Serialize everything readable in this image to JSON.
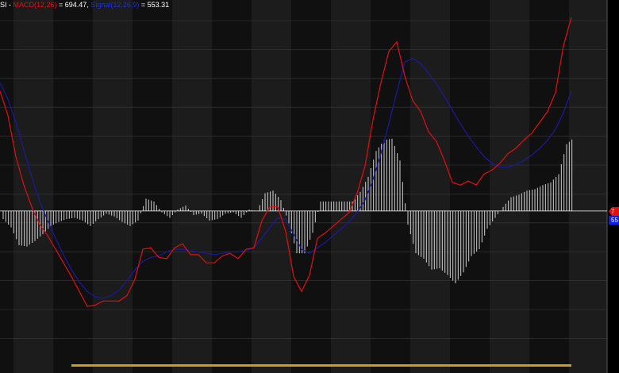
{
  "legend": {
    "prefix": "SI - ",
    "macd_label": "MACD(12,26)",
    "macd_eq": " = 694.47, ",
    "signal_label": "Signal(12,26,9)",
    "signal_eq": " = 553.31"
  },
  "price_tags": {
    "macd_tag": "7",
    "signal_tag": "55"
  },
  "colors": {
    "background_dark": "#101010",
    "background_light": "#1c1c1c",
    "grid": "#3a3a3a",
    "macd": "#e01010",
    "signal": "#1a1aa0",
    "histogram": "#d0d0d0",
    "zero_line": "#ffffff",
    "bottom_strip": "#c8a020"
  },
  "chart_data": {
    "type": "line",
    "title": "",
    "xlabel": "",
    "ylabel": "",
    "ylim": [
      -1100,
      1430
    ],
    "grid": true,
    "series": [
      {
        "name": "MACD(12,26)",
        "color": "#e01010",
        "x": [
          0,
          10,
          20,
          30,
          40,
          50,
          60,
          70,
          80,
          90,
          100,
          110,
          120,
          130,
          140,
          150,
          160,
          170,
          180,
          190,
          200,
          210,
          220,
          230,
          240,
          250,
          260,
          270,
          280,
          290,
          300,
          310,
          320,
          330,
          340,
          350,
          360,
          370,
          380,
          390,
          400,
          410,
          420,
          430,
          440,
          450,
          460,
          470,
          480,
          490,
          500,
          510,
          520,
          530,
          540,
          550,
          560,
          570,
          580,
          590,
          600,
          610,
          620,
          630,
          640,
          650,
          660,
          670,
          680,
          690,
          700,
          710,
          720
        ],
        "values": [
          880,
          700,
          400,
          190,
          30,
          -100,
          -180,
          -280,
          -380,
          -480,
          -590,
          -700,
          -690,
          -660,
          -660,
          -660,
          -620,
          -500,
          -280,
          -270,
          -340,
          -350,
          -270,
          -240,
          -320,
          -320,
          -380,
          -380,
          -330,
          -310,
          -350,
          -280,
          -270,
          -70,
          30,
          30,
          -150,
          -480,
          -590,
          -470,
          -200,
          -160,
          -110,
          -60,
          -10,
          130,
          330,
          670,
          940,
          1170,
          1240,
          990,
          810,
          730,
          580,
          510,
          370,
          210,
          190,
          220,
          190,
          270,
          300,
          350,
          420,
          460,
          520,
          570,
          650,
          730,
          870,
          1210,
          1420
        ]
      },
      {
        "name": "Signal(12,26,9)",
        "color": "#1a1aa0",
        "x": [
          0,
          10,
          20,
          30,
          40,
          50,
          60,
          70,
          80,
          90,
          100,
          110,
          120,
          130,
          140,
          150,
          160,
          170,
          180,
          190,
          200,
          210,
          220,
          230,
          240,
          250,
          260,
          270,
          280,
          290,
          300,
          310,
          320,
          330,
          340,
          350,
          360,
          370,
          380,
          390,
          400,
          410,
          420,
          430,
          440,
          450,
          460,
          470,
          480,
          490,
          500,
          510,
          520,
          530,
          540,
          550,
          560,
          570,
          580,
          590,
          600,
          610,
          620,
          630,
          640,
          650,
          660,
          670,
          680,
          690,
          700,
          710,
          720
        ],
        "values": [
          940,
          820,
          650,
          450,
          250,
          70,
          -70,
          -200,
          -320,
          -430,
          -520,
          -590,
          -630,
          -640,
          -620,
          -580,
          -510,
          -430,
          -370,
          -340,
          -330,
          -300,
          -280,
          -280,
          -290,
          -300,
          -310,
          -320,
          -310,
          -300,
          -300,
          -290,
          -270,
          -200,
          -120,
          -50,
          -60,
          -170,
          -280,
          -310,
          -270,
          -230,
          -180,
          -130,
          -80,
          -10,
          80,
          230,
          420,
          640,
          870,
          1090,
          1120,
          1080,
          1010,
          930,
          840,
          740,
          640,
          550,
          470,
          400,
          350,
          320,
          320,
          340,
          370,
          410,
          460,
          520,
          600,
          720,
          880
        ]
      }
    ],
    "histogram": {
      "name": "MACD - Signal",
      "color": "#d0d0d0",
      "x": [
        0,
        10,
        20,
        30,
        40,
        50,
        60,
        70,
        80,
        90,
        100,
        110,
        120,
        130,
        140,
        150,
        160,
        170,
        180,
        190,
        200,
        210,
        220,
        230,
        240,
        250,
        260,
        270,
        280,
        290,
        300,
        310,
        320,
        330,
        340,
        350,
        360,
        370,
        380,
        390,
        400,
        410,
        420,
        430,
        440,
        450,
        460,
        470,
        480,
        490,
        500,
        510,
        520,
        530,
        540,
        550,
        560,
        570,
        580,
        590,
        600,
        610,
        620,
        630,
        640,
        650,
        660,
        670,
        680,
        690,
        700,
        710,
        720
      ],
      "values": [
        -60,
        -120,
        -250,
        -260,
        -220,
        -170,
        -110,
        -80,
        -60,
        -50,
        -70,
        -110,
        -60,
        -20,
        -40,
        -80,
        -110,
        -70,
        90,
        70,
        -10,
        -50,
        10,
        40,
        -30,
        -20,
        -70,
        -60,
        -20,
        -10,
        -50,
        10,
        0,
        130,
        150,
        80,
        -90,
        -310,
        -310,
        -160,
        70,
        70,
        70,
        70,
        70,
        140,
        250,
        440,
        520,
        530,
        370,
        -100,
        -310,
        -350,
        -430,
        -420,
        -470,
        -530,
        -450,
        -330,
        -280,
        -130,
        -50,
        30,
        100,
        120,
        150,
        160,
        190,
        210,
        270,
        490,
        540
      ]
    }
  }
}
